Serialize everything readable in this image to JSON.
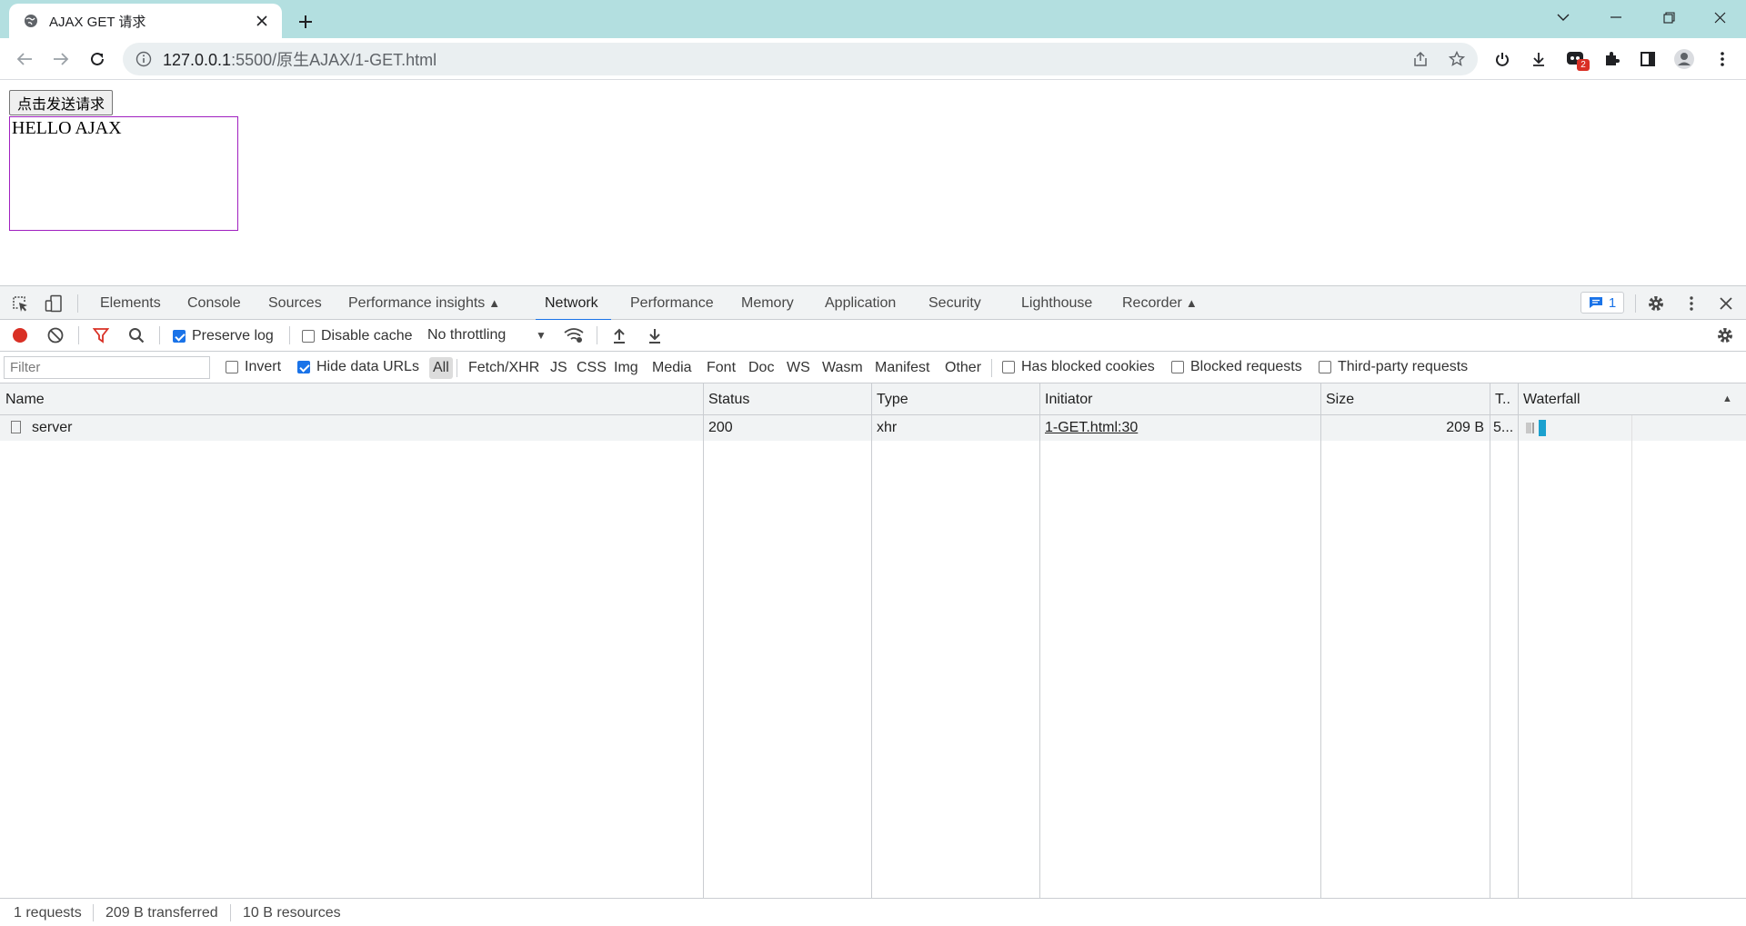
{
  "browser": {
    "tab": {
      "title": "AJAX GET 请求"
    },
    "url": {
      "host": "127.0.0.1",
      "rest": ":5500/原生AJAX/1-GET.html"
    },
    "extension_badge": "2"
  },
  "page": {
    "send_button": "点击发送请求",
    "result_text": "HELLO AJAX"
  },
  "devtools": {
    "tabs": [
      "Elements",
      "Console",
      "Sources",
      "Performance insights",
      "Network",
      "Performance",
      "Memory",
      "Application",
      "Security",
      "Lighthouse",
      "Recorder"
    ],
    "active_tab": "Network",
    "issues_count": "1",
    "toolbar": {
      "preserve_log": "Preserve log",
      "disable_cache": "Disable cache",
      "throttling": "No throttling"
    },
    "filter": {
      "placeholder": "Filter",
      "invert": "Invert",
      "hide_data_urls": "Hide data URLs",
      "types": [
        "All",
        "Fetch/XHR",
        "JS",
        "CSS",
        "Img",
        "Media",
        "Font",
        "Doc",
        "WS",
        "Wasm",
        "Manifest",
        "Other"
      ],
      "has_blocked_cookies": "Has blocked cookies",
      "blocked_requests": "Blocked requests",
      "third_party": "Third-party requests"
    },
    "columns": {
      "name": "Name",
      "status": "Status",
      "type": "Type",
      "initiator": "Initiator",
      "size": "Size",
      "time": "T..",
      "waterfall": "Waterfall"
    },
    "requests": [
      {
        "name": "server",
        "status": "200",
        "type": "xhr",
        "initiator": "1-GET.html:30",
        "size": "209 B",
        "time": "5..."
      }
    ],
    "status_bar": {
      "requests": "1 requests",
      "transferred": "209 B transferred",
      "resources": "10 B resources"
    }
  }
}
